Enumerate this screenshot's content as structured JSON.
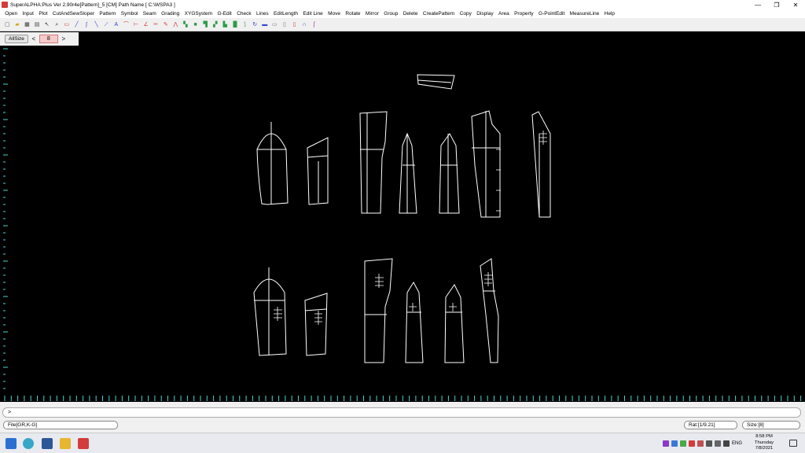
{
  "window": {
    "title": "SuperALPHA:Plus Ver 2.90r4e[Pattern]_5 [CM]  Path Name  [ C:\\WSPA3 ]",
    "controls": [
      "—",
      "❐",
      "✕"
    ]
  },
  "menu": [
    "Open",
    "Input",
    "Plot",
    "CutAndSewSloper",
    "Pattern",
    "Symbol",
    "Seam",
    "Grading",
    "XYGSystem",
    "G-Edit",
    "Check",
    "Lines",
    "EditLength",
    "Edit Line",
    "Move",
    "Rotate",
    "Mirror",
    "Group",
    "Delete",
    "CreatePattern",
    "Copy",
    "Display",
    "Area",
    "Property",
    "G-PointEdit",
    "MeasureLine",
    "Help"
  ],
  "toolbar": {
    "buttons": [
      {
        "icon": "new-icon",
        "glyph": "▢",
        "color": "#555"
      },
      {
        "icon": "open-icon",
        "glyph": "▰",
        "color": "#d8a520"
      },
      {
        "icon": "save-icon",
        "glyph": "▦",
        "color": "#333"
      },
      {
        "icon": "print-icon",
        "glyph": "▤",
        "color": "#444"
      },
      {
        "icon": "select-icon",
        "glyph": "↖",
        "color": "#333"
      },
      {
        "icon": "zoom-icon",
        "glyph": "⌕",
        "color": "#333"
      },
      {
        "icon": "page-icon",
        "glyph": "▭",
        "color": "#d43b3b"
      },
      {
        "icon": "line-icon",
        "glyph": "╱",
        "color": "#3344cc"
      },
      {
        "icon": "curve-icon",
        "glyph": "∫",
        "color": "#3344cc"
      },
      {
        "icon": "diagonal-icon",
        "glyph": "╲",
        "color": "#3344cc"
      },
      {
        "icon": "polyline-icon",
        "glyph": "⟋",
        "color": "#3344cc"
      },
      {
        "icon": "text-icon",
        "glyph": "A",
        "color": "#3344cc"
      },
      {
        "icon": "arc-icon",
        "glyph": "⌒",
        "color": "#d43b3b"
      },
      {
        "icon": "perpendicular-icon",
        "glyph": "⊢",
        "color": "#d43b3b"
      },
      {
        "icon": "angle-icon",
        "glyph": "∠",
        "color": "#d43b3b"
      },
      {
        "icon": "cut-icon",
        "glyph": "✂",
        "color": "#d43b3b"
      },
      {
        "icon": "pen-icon",
        "glyph": "✎",
        "color": "#d43b3b"
      },
      {
        "icon": "dart-icon",
        "glyph": "⋀",
        "color": "#d43b3b"
      },
      {
        "icon": "pattern-icon",
        "glyph": "▚",
        "color": "#2e9a4a"
      },
      {
        "icon": "fill-icon",
        "glyph": "■",
        "color": "#2e9a4a"
      },
      {
        "icon": "grade-icon",
        "glyph": "▜",
        "color": "#2e9a4a"
      },
      {
        "icon": "copy-icon",
        "glyph": "▞",
        "color": "#2e9a4a"
      },
      {
        "icon": "layer-icon",
        "glyph": "▙",
        "color": "#2e9a4a"
      },
      {
        "icon": "block-icon",
        "glyph": "█",
        "color": "#2e9a4a"
      },
      {
        "icon": "brush-icon",
        "glyph": "⟆",
        "color": "#2e9a4a"
      },
      {
        "icon": "rotate-icon",
        "glyph": "↻",
        "color": "#3344cc"
      },
      {
        "icon": "folder-icon",
        "glyph": "▬",
        "color": "#3344cc"
      },
      {
        "icon": "window-icon",
        "glyph": "▭",
        "color": "#777"
      },
      {
        "icon": "doc-icon",
        "glyph": "▯",
        "color": "#777"
      },
      {
        "icon": "mirror-icon",
        "glyph": "▯",
        "color": "#d43b3b"
      },
      {
        "icon": "bracket-icon",
        "glyph": "∩",
        "color": "#3344cc"
      },
      {
        "icon": "hook-icon",
        "glyph": "ʃ",
        "color": "#8a2ea0"
      }
    ]
  },
  "size_bar": {
    "allsize_label": "AllSize",
    "prev": "<",
    "value": "8",
    "next": ">"
  },
  "command_line": {
    "prompt": ">"
  },
  "status": {
    "file": "File[GR,K-G]",
    "ratio": "Rat:[1/9.21]",
    "size": "Size:[8]"
  },
  "taskbar": {
    "lang": "ENG",
    "time": "8:58 PM",
    "day": "Thursday",
    "date": "7/8/2021"
  },
  "colors": {
    "canvas": "#000000",
    "pattern_line": "#ffffff",
    "ruler_tick": "#4bd3d3"
  }
}
